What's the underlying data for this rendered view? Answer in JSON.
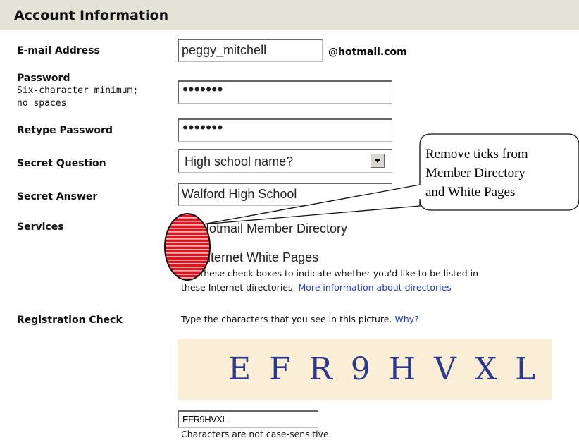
{
  "section": {
    "title": "Account Information"
  },
  "fields": {
    "email": {
      "label": "E-mail Address",
      "value": "peggy_mitchell",
      "domain": "@hotmail.com"
    },
    "password": {
      "label": "Password",
      "hint_line1": "Six-character minimum;",
      "hint_line2": "no spaces",
      "value": "•••••••"
    },
    "retype_password": {
      "label": "Retype Password",
      "value": "•••••••"
    },
    "secret_question": {
      "label": "Secret Question",
      "value": "High school name?"
    },
    "secret_answer": {
      "label": "Secret Answer",
      "value": "Walford High School"
    }
  },
  "services": {
    "label": "Services",
    "items": [
      {
        "label": "Hotmail Member Directory"
      },
      {
        "label": "Internet White Pages"
      }
    ],
    "help_line1": "Use these check boxes to indicate whether you'd like to be listed in",
    "help_line2_prefix": "these Internet directories.",
    "help_link": "More information about directories"
  },
  "registration": {
    "label": "Registration Check",
    "instruction": "Type the characters that you see in this picture.",
    "why_link": "Why?",
    "captcha_text": "EFR9HVXL",
    "captcha_display": "E F R 9 H V  X L",
    "input_value": "EFR9HVXL",
    "note": "Characters are not case-sensitive."
  },
  "callout": {
    "line1": "Remove ticks from",
    "line2": "Member Directory",
    "line3": "and White Pages"
  },
  "colors": {
    "header_bg": "#e3e3d8",
    "link": "#1a3ec8",
    "highlight_red": "#e0141c",
    "captcha_bg": "#fbeed6"
  }
}
